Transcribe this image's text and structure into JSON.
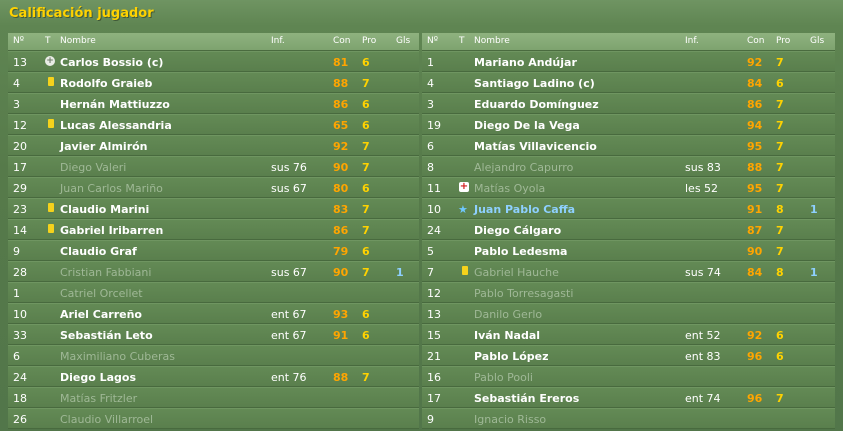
{
  "title": "Calificación jugador",
  "headers": {
    "num": "Nº",
    "t": "T",
    "name": "Nombre",
    "inf": "Inf.",
    "con": "Con",
    "pro": "Pro",
    "gls": "Gls"
  },
  "left": [
    {
      "num": "13",
      "icon": "plus",
      "name": "Carlos Bossio (c)",
      "inf": "",
      "con": "81",
      "pro": "6",
      "gls": "",
      "dim": false
    },
    {
      "num": "4",
      "icon": "yellow",
      "name": "Rodolfo Graieb",
      "inf": "",
      "con": "88",
      "pro": "7",
      "gls": "",
      "dim": false
    },
    {
      "num": "3",
      "icon": "",
      "name": "Hernán Mattiuzzo",
      "inf": "",
      "con": "86",
      "pro": "6",
      "gls": "",
      "dim": false
    },
    {
      "num": "12",
      "icon": "yellow",
      "name": "Lucas Alessandria",
      "inf": "",
      "con": "65",
      "pro": "6",
      "gls": "",
      "dim": false
    },
    {
      "num": "20",
      "icon": "",
      "name": "Javier Almirón",
      "inf": "",
      "con": "92",
      "pro": "7",
      "gls": "",
      "dim": false
    },
    {
      "num": "17",
      "icon": "",
      "name": "Diego Valeri",
      "inf": "sus 76",
      "con": "90",
      "pro": "7",
      "gls": "",
      "dim": true
    },
    {
      "num": "29",
      "icon": "",
      "name": "Juan Carlos Mariño",
      "inf": "sus 67",
      "con": "80",
      "pro": "6",
      "gls": "",
      "dim": true
    },
    {
      "num": "23",
      "icon": "yellow",
      "name": "Claudio Marini",
      "inf": "",
      "con": "83",
      "pro": "7",
      "gls": "",
      "dim": false
    },
    {
      "num": "14",
      "icon": "yellow",
      "name": "Gabriel Iribarren",
      "inf": "",
      "con": "86",
      "pro": "7",
      "gls": "",
      "dim": false
    },
    {
      "num": "9",
      "icon": "",
      "name": "Claudio Graf",
      "inf": "",
      "con": "79",
      "pro": "6",
      "gls": "",
      "dim": false
    },
    {
      "num": "28",
      "icon": "",
      "name": "Cristian Fabbiani",
      "inf": "sus 67",
      "con": "90",
      "pro": "7",
      "gls": "1",
      "dim": true
    },
    {
      "num": "1",
      "icon": "",
      "name": "Catriel Orcellet",
      "inf": "",
      "con": "",
      "pro": "",
      "gls": "",
      "dim": true
    },
    {
      "num": "10",
      "icon": "",
      "name": "Ariel Carreño",
      "inf": "ent 67",
      "con": "93",
      "pro": "6",
      "gls": "",
      "dim": false
    },
    {
      "num": "33",
      "icon": "",
      "name": "Sebastián Leto",
      "inf": "ent 67",
      "con": "91",
      "pro": "6",
      "gls": "",
      "dim": false
    },
    {
      "num": "6",
      "icon": "",
      "name": "Maximiliano Cuberas",
      "inf": "",
      "con": "",
      "pro": "",
      "gls": "",
      "dim": true
    },
    {
      "num": "24",
      "icon": "",
      "name": "Diego Lagos",
      "inf": "ent 76",
      "con": "88",
      "pro": "7",
      "gls": "",
      "dim": false
    },
    {
      "num": "18",
      "icon": "",
      "name": "Matías Fritzler",
      "inf": "",
      "con": "",
      "pro": "",
      "gls": "",
      "dim": true
    },
    {
      "num": "26",
      "icon": "",
      "name": "Claudio Villarroel",
      "inf": "",
      "con": "",
      "pro": "",
      "gls": "",
      "dim": true
    }
  ],
  "right": [
    {
      "num": "1",
      "icon": "",
      "name": "Mariano Andújar",
      "inf": "",
      "con": "92",
      "pro": "7",
      "gls": "",
      "dim": false
    },
    {
      "num": "4",
      "icon": "",
      "name": "Santiago Ladino (c)",
      "inf": "",
      "con": "84",
      "pro": "6",
      "gls": "",
      "dim": false
    },
    {
      "num": "3",
      "icon": "",
      "name": "Eduardo Domínguez",
      "inf": "",
      "con": "86",
      "pro": "7",
      "gls": "",
      "dim": false
    },
    {
      "num": "19",
      "icon": "",
      "name": "Diego De la Vega",
      "inf": "",
      "con": "94",
      "pro": "7",
      "gls": "",
      "dim": false
    },
    {
      "num": "6",
      "icon": "",
      "name": "Matías Villavicencio",
      "inf": "",
      "con": "95",
      "pro": "7",
      "gls": "",
      "dim": false
    },
    {
      "num": "8",
      "icon": "",
      "name": "Alejandro Capurro",
      "inf": "sus 83",
      "con": "88",
      "pro": "7",
      "gls": "",
      "dim": true
    },
    {
      "num": "11",
      "icon": "cross",
      "name": "Matías Oyola",
      "inf": "les 52",
      "con": "95",
      "pro": "7",
      "gls": "",
      "dim": true
    },
    {
      "num": "10",
      "icon": "star",
      "name": "Juan Pablo Caffa",
      "inf": "",
      "con": "91",
      "pro": "8",
      "gls": "1",
      "dim": false,
      "star": true
    },
    {
      "num": "24",
      "icon": "",
      "name": "Diego Cálgaro",
      "inf": "",
      "con": "87",
      "pro": "7",
      "gls": "",
      "dim": false
    },
    {
      "num": "5",
      "icon": "",
      "name": "Pablo Ledesma",
      "inf": "",
      "con": "90",
      "pro": "7",
      "gls": "",
      "dim": false
    },
    {
      "num": "7",
      "icon": "yellow",
      "name": "Gabriel Hauche",
      "inf": "sus 74",
      "con": "84",
      "pro": "8",
      "gls": "1",
      "dim": true
    },
    {
      "num": "12",
      "icon": "",
      "name": "Pablo Torresagasti",
      "inf": "",
      "con": "",
      "pro": "",
      "gls": "",
      "dim": true
    },
    {
      "num": "13",
      "icon": "",
      "name": "Danilo Gerlo",
      "inf": "",
      "con": "",
      "pro": "",
      "gls": "",
      "dim": true
    },
    {
      "num": "15",
      "icon": "",
      "name": "Iván Nadal",
      "inf": "ent 52",
      "con": "92",
      "pro": "6",
      "gls": "",
      "dim": false
    },
    {
      "num": "21",
      "icon": "",
      "name": "Pablo López",
      "inf": "ent 83",
      "con": "96",
      "pro": "6",
      "gls": "",
      "dim": false
    },
    {
      "num": "16",
      "icon": "",
      "name": "Pablo Pooli",
      "inf": "",
      "con": "",
      "pro": "",
      "gls": "",
      "dim": true
    },
    {
      "num": "17",
      "icon": "",
      "name": "Sebastián Ereros",
      "inf": "ent 74",
      "con": "96",
      "pro": "7",
      "gls": "",
      "dim": false
    },
    {
      "num": "9",
      "icon": "",
      "name": "Ignacio Risso",
      "inf": "",
      "con": "",
      "pro": "",
      "gls": "",
      "dim": true
    }
  ]
}
